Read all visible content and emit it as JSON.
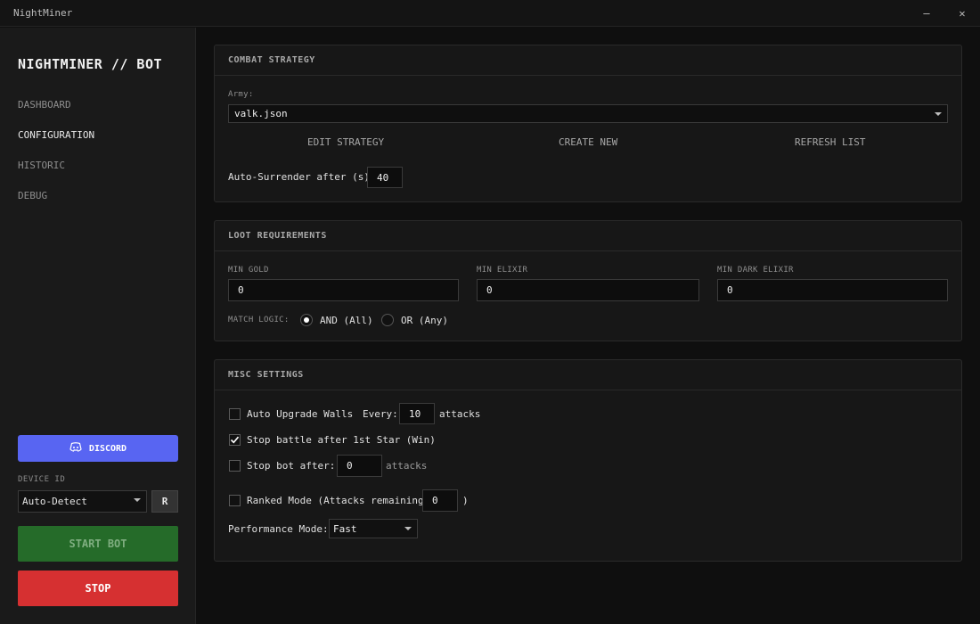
{
  "window": {
    "title": "NightMiner",
    "minimize_label": "—",
    "close_label": "✕"
  },
  "sidebar": {
    "brand": "NIGHTMINER // BOT",
    "nav": [
      {
        "label": "DASHBOARD",
        "active": false
      },
      {
        "label": "CONFIGURATION",
        "active": true
      },
      {
        "label": "HISTORIC",
        "active": false
      },
      {
        "label": "DEBUG",
        "active": false
      }
    ],
    "discord_label": "DISCORD",
    "discord_color": "#5865f2",
    "device_id_label": "DEVICE ID",
    "device_value": "Auto-Detect",
    "refresh_label": "R",
    "start_label": "START BOT",
    "start_color": "#256b29",
    "stop_label": "STOP",
    "stop_color": "#d63031"
  },
  "combat": {
    "header": "COMBAT STRATEGY",
    "army_label": "Army:",
    "army_value": "valk.json",
    "edit_label": "EDIT STRATEGY",
    "create_label": "CREATE NEW",
    "refresh_label": "REFRESH LIST",
    "surrender_label": "Auto-Surrender after (s):",
    "surrender_value": "40"
  },
  "loot": {
    "header": "LOOT REQUIREMENTS",
    "gold_label": "MIN GOLD",
    "gold_value": "0",
    "elixir_label": "MIN ELIXIR",
    "elixir_value": "0",
    "dark_label": "MIN DARK ELIXIR",
    "dark_value": "0",
    "match_label": "MATCH LOGIC:",
    "and_label": "AND (All)",
    "or_label": "OR (Any)",
    "selected_logic": "and"
  },
  "misc": {
    "header": "MISC SETTINGS",
    "walls_label": "Auto Upgrade Walls",
    "walls_checked": false,
    "every_label": "Every:",
    "every_value": "10",
    "attacks_label": "attacks",
    "star_label": "Stop battle after 1st Star (Win)",
    "star_checked": true,
    "stopbot_label": "Stop bot after:",
    "stopbot_checked": false,
    "stopbot_value": "0",
    "stopbot_attacks": "attacks",
    "ranked_label": "Ranked Mode  (Attacks remaining:",
    "ranked_checked": false,
    "ranked_value": "0",
    "ranked_close": ")",
    "perf_label": "Performance Mode:",
    "perf_value": "Fast"
  }
}
